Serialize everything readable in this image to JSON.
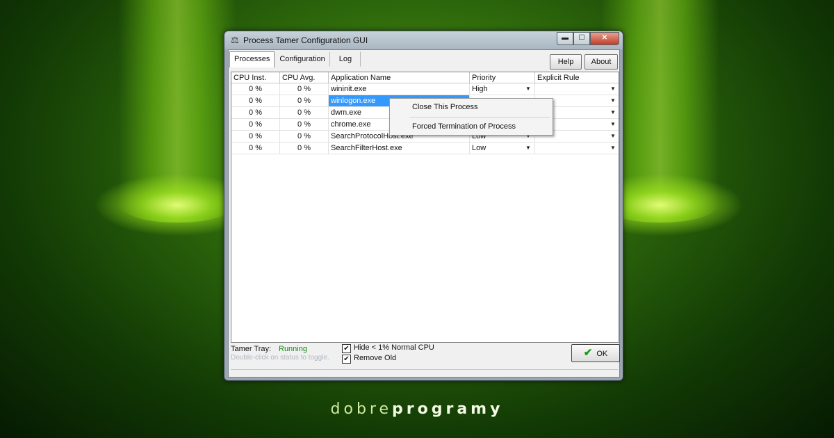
{
  "window": {
    "title": "Process Tamer Configuration GUI",
    "icon": "scales-icon"
  },
  "tabs": [
    {
      "label": "Processes",
      "active": true
    },
    {
      "label": "Configuration",
      "active": false
    },
    {
      "label": "Log",
      "active": false
    }
  ],
  "buttons": {
    "help": "Help",
    "about": "About",
    "ok": "OK"
  },
  "table": {
    "columns": [
      "CPU Inst.",
      "CPU Avg.",
      "Application Name",
      "Priority",
      "Explicit Rule"
    ],
    "rows": [
      {
        "cpu_inst": "0 %",
        "cpu_avg": "0 %",
        "name": "wininit.exe",
        "priority": "High",
        "rule": ""
      },
      {
        "cpu_inst": "0 %",
        "cpu_avg": "0 %",
        "name": "winlogon.exe",
        "priority": "",
        "rule": "",
        "selected": true
      },
      {
        "cpu_inst": "0 %",
        "cpu_avg": "0 %",
        "name": "dwm.exe",
        "priority": "",
        "rule": ""
      },
      {
        "cpu_inst": "0 %",
        "cpu_avg": "0 %",
        "name": "chrome.exe",
        "priority": "",
        "rule": ""
      },
      {
        "cpu_inst": "0 %",
        "cpu_avg": "0 %",
        "name": "SearchProtocolHost.exe",
        "priority": "Low",
        "rule": ""
      },
      {
        "cpu_inst": "0 %",
        "cpu_avg": "0 %",
        "name": "SearchFilterHost.exe",
        "priority": "Low",
        "rule": ""
      }
    ]
  },
  "context_menu": {
    "items": [
      "Close This Process",
      "Forced Termination of Process"
    ]
  },
  "footer": {
    "tray_label": "Tamer Tray:",
    "tray_status": "Running",
    "hint": "Double-click on status to toggle.",
    "hide_label": "Hide < 1% Normal CPU",
    "hide_checked": true,
    "remove_label": "Remove Old",
    "remove_checked": true
  },
  "brand": {
    "light": "dobre",
    "bold": "programy"
  },
  "colors": {
    "selection": "#3399ff",
    "running": "#118a11",
    "background": "#2f6a0c"
  }
}
